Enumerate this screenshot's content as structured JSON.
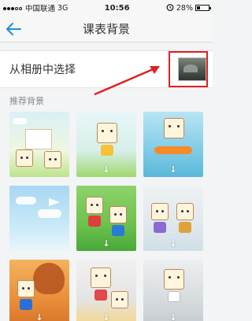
{
  "status_bar": {
    "carrier": "中国联通",
    "network": "3G",
    "time": "10:56",
    "battery_percent": "28%",
    "battery_level": 0.28
  },
  "nav": {
    "title": "课表背景",
    "back_icon": "back-arrow-icon"
  },
  "album": {
    "label": "从相册中选择",
    "thumbnail_icon": "photo-thumbnail"
  },
  "recommended": {
    "label": "推荐背景",
    "download_glyph": "↓",
    "tiles": [
      {
        "name": "school-scene",
        "downloadable": false
      },
      {
        "name": "cartoon-hearts",
        "downloadable": true
      },
      {
        "name": "cartoon-surfing",
        "downloadable": true
      },
      {
        "name": "sky-paper-plane",
        "downloadable": false
      },
      {
        "name": "cartoon-superhero",
        "downloadable": true
      },
      {
        "name": "cartoon-grandparents",
        "downloadable": true
      },
      {
        "name": "autumn-tree",
        "downloadable": true
      },
      {
        "name": "cartoon-kids",
        "downloadable": true
      },
      {
        "name": "cartoon-kitchen",
        "downloadable": true
      }
    ]
  },
  "colors": {
    "accent_blue": "#1a8fe0",
    "annotation_red": "#e02020"
  }
}
